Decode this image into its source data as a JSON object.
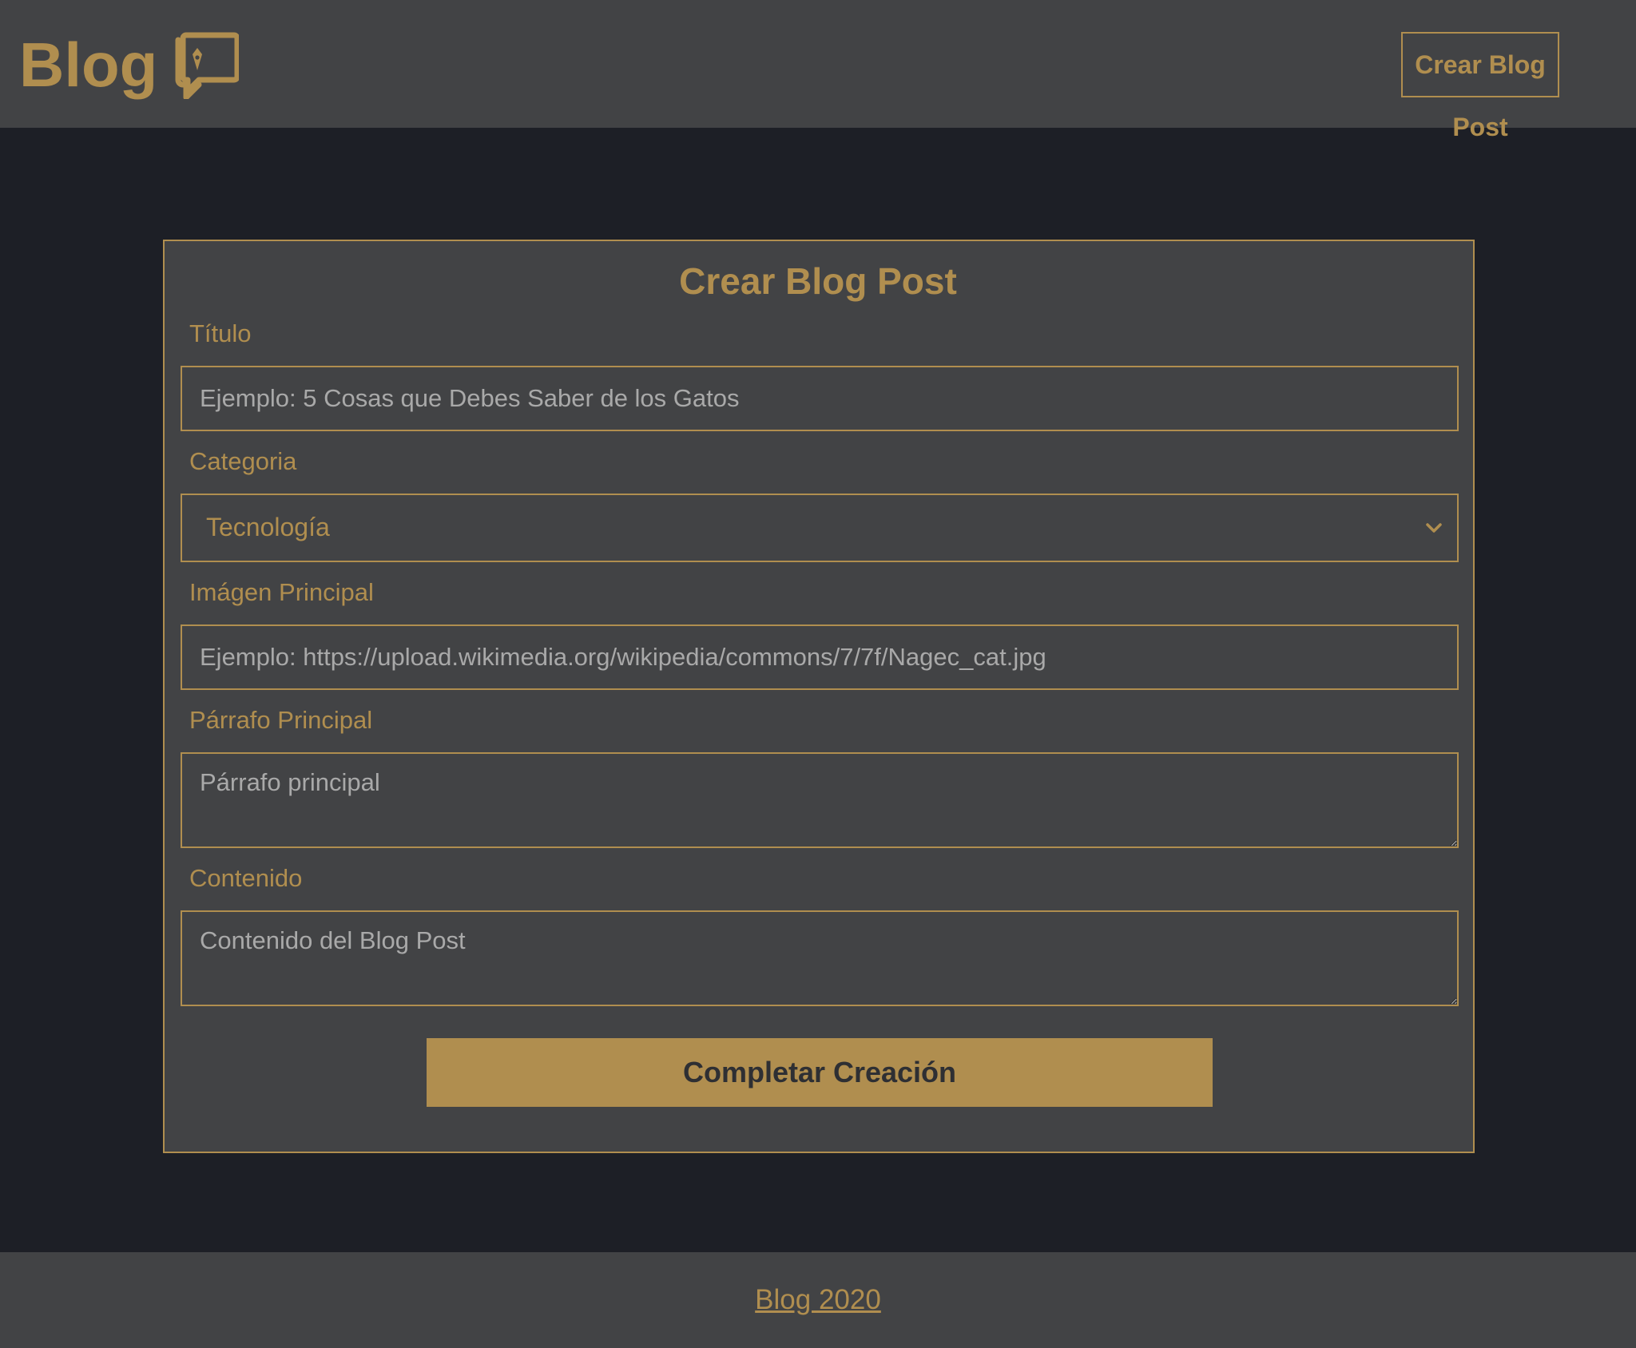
{
  "header": {
    "logo_text": "Blog",
    "logo_icon": "chat-pen-icon",
    "create_button_label": "Crear Blog Post"
  },
  "form": {
    "title": "Crear Blog Post",
    "fields": {
      "titulo": {
        "label": "Título",
        "value": "",
        "placeholder": "Ejemplo: 5 Cosas que Debes Saber de los Gatos"
      },
      "categoria": {
        "label": "Categoria",
        "selected": "Tecnología"
      },
      "imagen": {
        "label": "Imágen Principal",
        "value": "",
        "placeholder": "Ejemplo: https://upload.wikimedia.org/wikipedia/commons/7/7f/Nagec_cat.jpg"
      },
      "parrafo": {
        "label": "Párrafo Principal",
        "value": "",
        "placeholder": "Párrafo principal"
      },
      "contenido": {
        "label": "Contenido",
        "value": "",
        "placeholder": "Contenido del Blog Post"
      }
    },
    "submit_label": "Completar Creación"
  },
  "footer": {
    "link_text": "Blog 2020"
  },
  "colors": {
    "accent": "#b08e4f",
    "background": "#1d1f26",
    "surface": "#424345"
  }
}
